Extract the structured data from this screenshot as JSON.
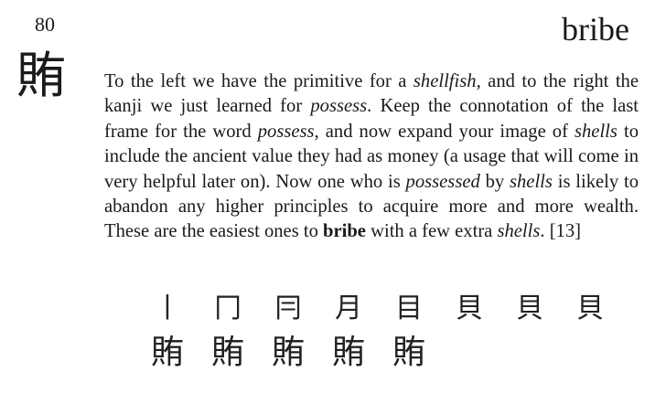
{
  "frame_number": "80",
  "keyword": "bribe",
  "kanji": "賄",
  "story": [
    {
      "t": "text",
      "v": "To the left we have the primitive for a "
    },
    {
      "t": "em",
      "v": "shellfish"
    },
    {
      "t": "text",
      "v": ", and to the right the kanji we just learned for "
    },
    {
      "t": "em",
      "v": "possess"
    },
    {
      "t": "text",
      "v": ". Keep the connotation of the last frame for the word "
    },
    {
      "t": "em",
      "v": "possess"
    },
    {
      "t": "text",
      "v": ", and now expand your image of "
    },
    {
      "t": "em",
      "v": "shells"
    },
    {
      "t": "text",
      "v": " to include the ancient value they had as money (a usage that will come in very helpful later on). Now one who is "
    },
    {
      "t": "em",
      "v": "possessed"
    },
    {
      "t": "text",
      "v": " by "
    },
    {
      "t": "em",
      "v": "shells"
    },
    {
      "t": "text",
      "v": " is likely to abandon any higher principles to acquire more and more wealth. These are the easiest ones to "
    },
    {
      "t": "b",
      "v": "bribe"
    },
    {
      "t": "text",
      "v": " with a few extra "
    },
    {
      "t": "em",
      "v": "shells"
    },
    {
      "t": "text",
      "v": ". [13]"
    }
  ],
  "stroke_order": {
    "row1": [
      "丨",
      "冂",
      "冃",
      "月",
      "目",
      "貝",
      "貝",
      "貝"
    ],
    "row2": [
      "賄",
      "賄",
      "賄",
      "賄",
      "賄"
    ]
  }
}
